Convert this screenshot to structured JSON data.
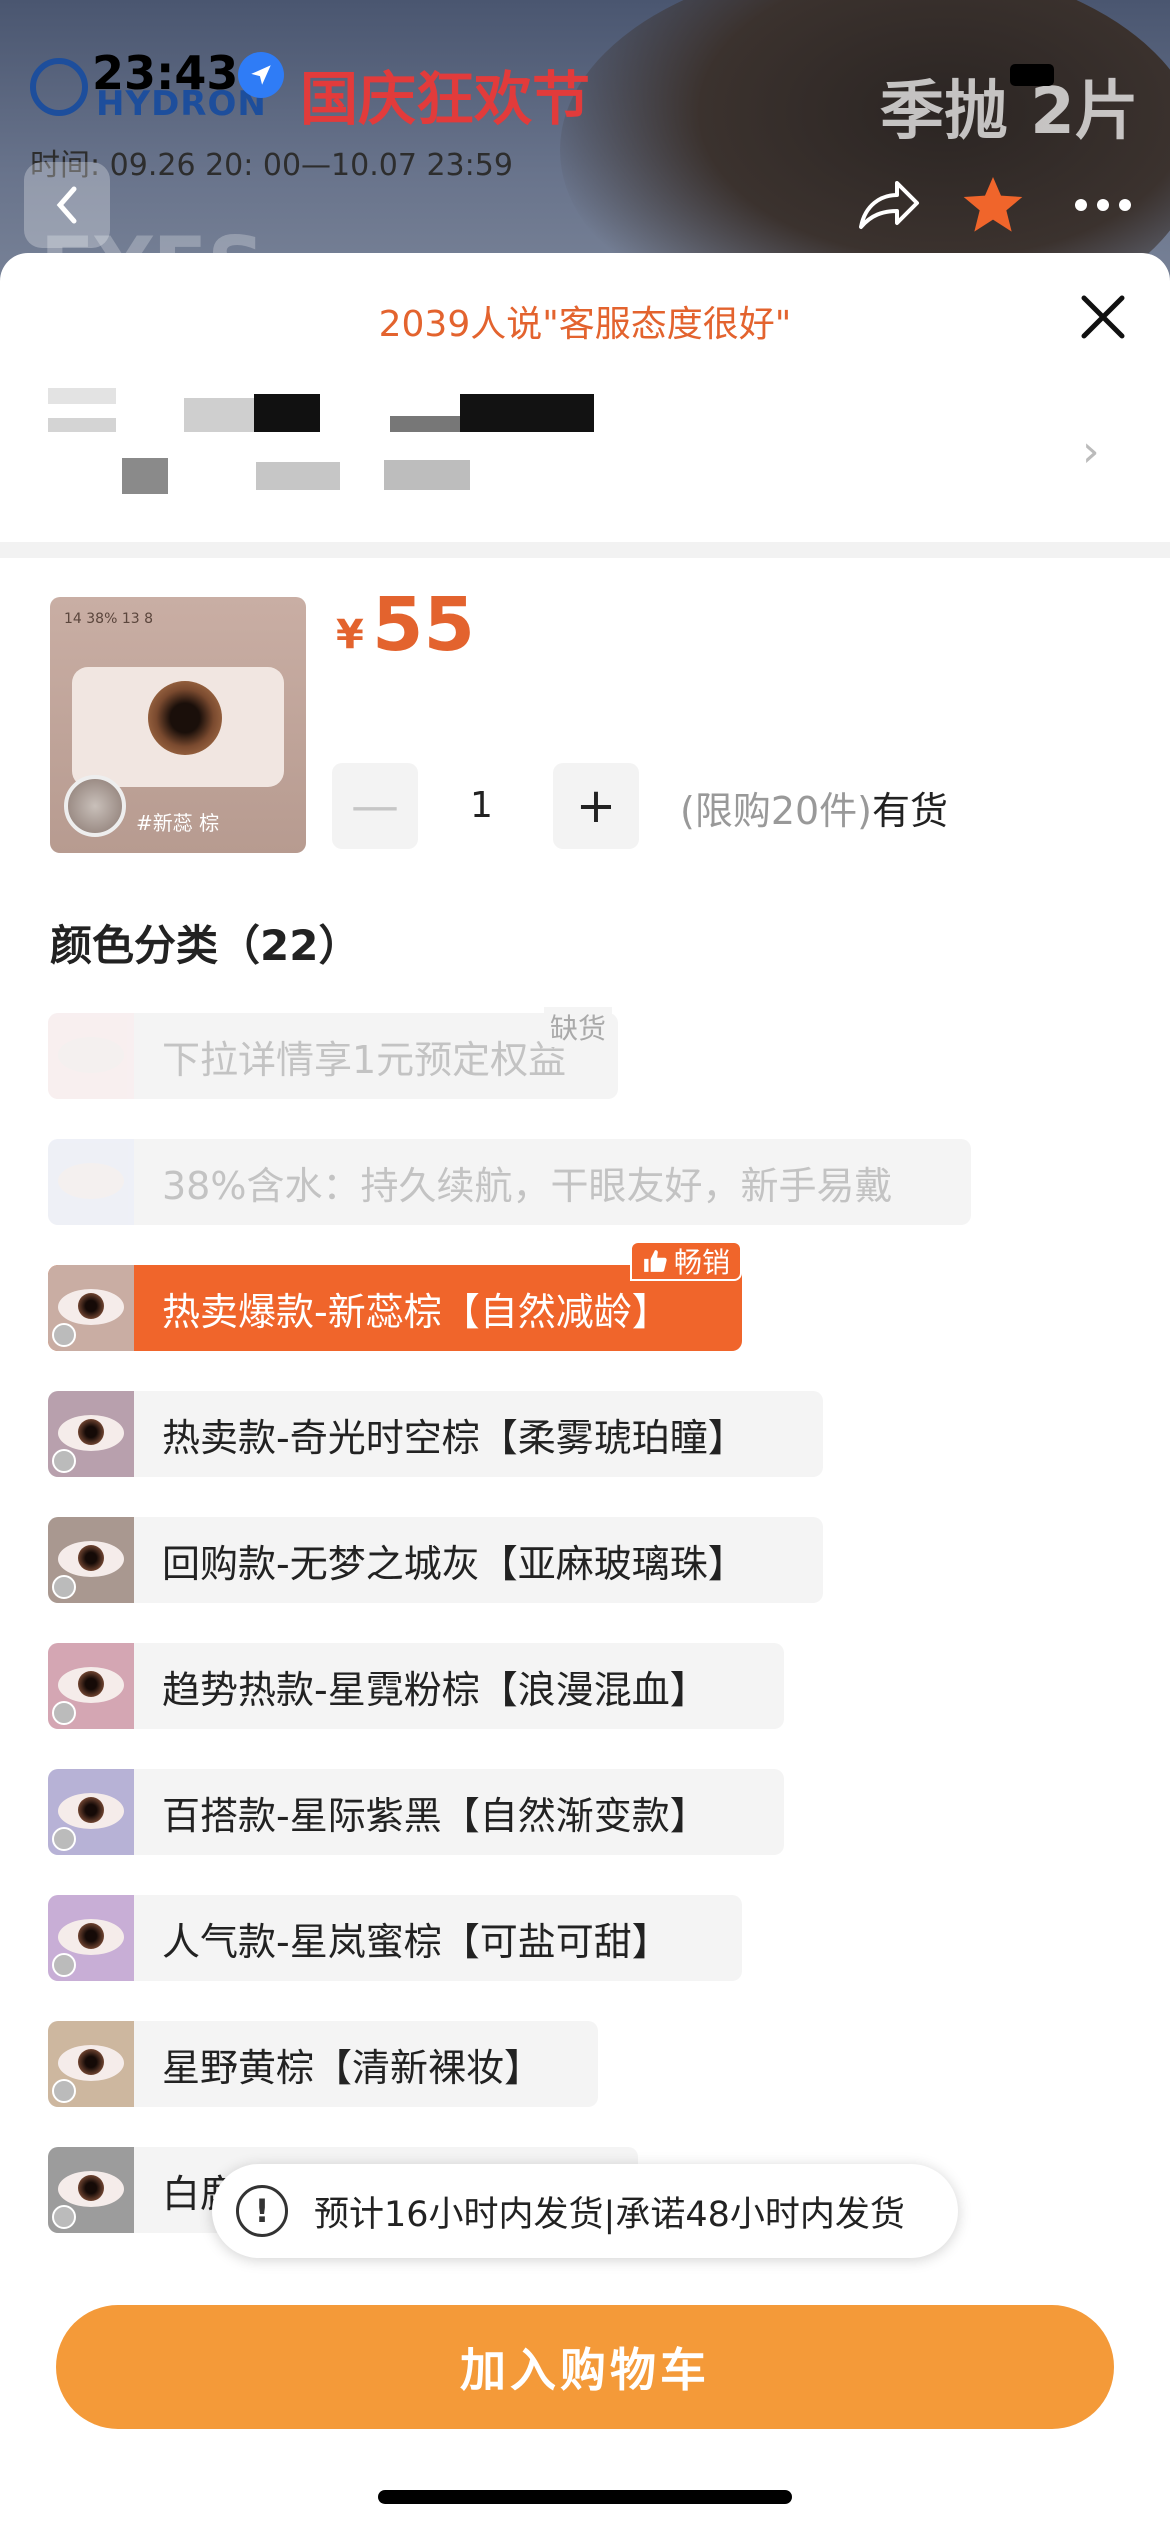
{
  "status_bar": {
    "time": "23:43"
  },
  "banner": {
    "brand": "HYDRON",
    "festival": "国庆狂欢节",
    "season_text": "季抛 2片",
    "time_range": "时间: 09.26 20: 00—10.07 23:59",
    "overlay_text": "EYES"
  },
  "nav": {
    "back": "‹",
    "share": "share",
    "favorite": "star",
    "more": "•••"
  },
  "sheet": {
    "praise": "2039人说\"客服态度很好\"",
    "close": "✕"
  },
  "product": {
    "currency": "¥",
    "price": "55",
    "quantity": "1",
    "minus": "—",
    "plus": "+",
    "limit_text": "(限购20件)",
    "stock_text": "有货",
    "thumb_tag": "#新蕊 棕",
    "thumb_stats": "14 38% 13 8"
  },
  "options": {
    "title": "颜色分类（22）",
    "items": [
      {
        "label": "下拉详情享1元预定权益",
        "badge": "缺货",
        "state": "disabled"
      },
      {
        "label": "38%含水：持久续航，干眼友好，新手易戴",
        "badge": "",
        "state": "disabled"
      },
      {
        "label": "热卖爆款-新蕊棕【自然减龄】",
        "badge": "畅销",
        "state": "selected"
      },
      {
        "label": "热卖款-奇光时空棕【柔雾琥珀瞳】",
        "badge": "",
        "state": "normal"
      },
      {
        "label": "回购款-无梦之城灰【亚麻玻璃珠】",
        "badge": "",
        "state": "normal"
      },
      {
        "label": "趋势热款-星霓粉棕【浪漫混血】",
        "badge": "",
        "state": "normal"
      },
      {
        "label": "百搭款-星际紫黑【自然渐变款】",
        "badge": "",
        "state": "normal"
      },
      {
        "label": "人气款-星岚蜜棕【可盐可甜】",
        "badge": "",
        "state": "normal"
      },
      {
        "label": "星野黄棕【清新裸妆】",
        "badge": "",
        "state": "normal"
      },
      {
        "label": "白鹿",
        "badge": "",
        "state": "normal"
      }
    ]
  },
  "toast": {
    "icon": "!",
    "text": "预计16小时内发货|承诺48小时内发货"
  },
  "cart_button": "加入购物车",
  "colors": {
    "accent": "#f0652b",
    "cart": "#f49a39",
    "praise": "#e3632e"
  }
}
